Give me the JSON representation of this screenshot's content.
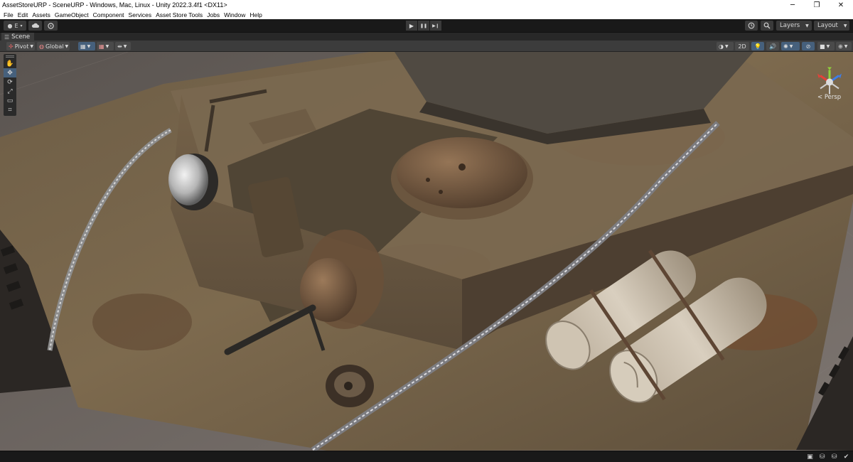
{
  "window": {
    "title": "AssetStoreURP - SceneURP - Windows, Mac, Linux - Unity 2022.3.4f1 <DX11>",
    "minimize": "─",
    "restore": "❐",
    "close": "✕"
  },
  "menu": [
    "File",
    "Edit",
    "Assets",
    "GameObject",
    "Component",
    "Services",
    "Asset Store Tools",
    "Jobs",
    "Window",
    "Help"
  ],
  "toolbar": {
    "account_label": "E",
    "play_icon": "▶",
    "pause_icon": "❚❚",
    "step_icon": "▶❙",
    "layers_label": "Layers",
    "layout_label": "Layout"
  },
  "scene_tab": {
    "label": "Scene",
    "icon": "☰"
  },
  "scene_toolbar": {
    "pivot_label": "Pivot",
    "global_label": "Global",
    "mode_2d_label": "2D"
  },
  "gizmo": {
    "persp_label": "< Persp",
    "colors": {
      "x": "#e5403a",
      "y": "#8fd03b",
      "z": "#3e7ee8"
    }
  },
  "tools": [
    "hand-tool",
    "move-tool",
    "rotate-tool",
    "scale-tool",
    "rect-tool",
    "transform-tool"
  ]
}
